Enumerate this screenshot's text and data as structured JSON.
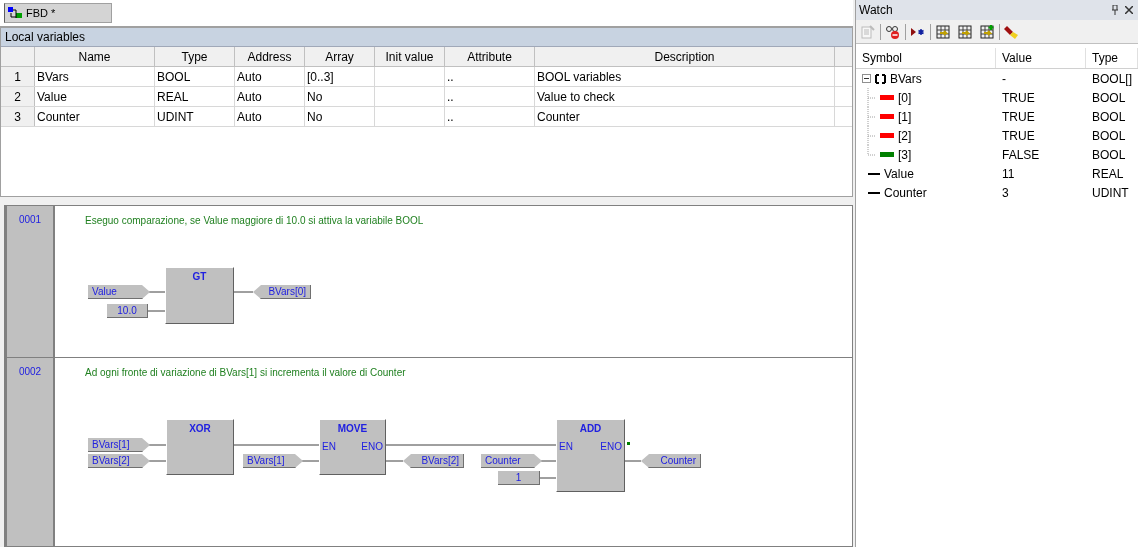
{
  "tabs": [
    {
      "label": "FBD *",
      "selected": true
    }
  ],
  "local_variables": {
    "title": "Local variables",
    "columns": [
      "Name",
      "Type",
      "Address",
      "Array",
      "Init value",
      "Attribute",
      "Description"
    ],
    "rows": [
      {
        "index": "1",
        "cells": [
          "BVars",
          "BOOL",
          "Auto",
          "[0..3]",
          "",
          "..",
          "BOOL variables"
        ]
      },
      {
        "index": "2",
        "cells": [
          "Value",
          "REAL",
          "Auto",
          "No",
          "",
          "..",
          "Value to check"
        ]
      },
      {
        "index": "3",
        "cells": [
          "Counter",
          "UDINT",
          "Auto",
          "No",
          "",
          "..",
          "Counter"
        ]
      }
    ]
  },
  "networks": [
    {
      "number": "0001",
      "comment": "Eseguo comparazione, se Value maggiore di 10.0 si attiva la variabile BOOL",
      "blocks": [
        {
          "name": "GT"
        }
      ],
      "elements": [
        {
          "kind": "input",
          "label": "Value"
        },
        {
          "kind": "constant",
          "label": "10.0"
        },
        {
          "kind": "output",
          "label": "BVars[0]"
        }
      ]
    },
    {
      "number": "0002",
      "comment": "Ad ogni fronte di variazione di BVars[1] si incrementa il valore di Counter",
      "blocks": [
        {
          "name": "XOR"
        },
        {
          "name": "MOVE",
          "pins": [
            "EN",
            "ENO"
          ]
        },
        {
          "name": "ADD",
          "pins": [
            "EN",
            "ENO"
          ]
        }
      ],
      "elements": [
        {
          "kind": "input",
          "label": "BVars[1]"
        },
        {
          "kind": "input",
          "label": "BVars[2]"
        },
        {
          "kind": "input",
          "label": "BVars[1]"
        },
        {
          "kind": "output",
          "label": "BVars[2]"
        },
        {
          "kind": "input",
          "label": "Counter"
        },
        {
          "kind": "constant",
          "label": "1"
        },
        {
          "kind": "output",
          "label": "Counter"
        }
      ]
    }
  ],
  "watch": {
    "title": "Watch",
    "columns": [
      "Symbol",
      "Value",
      "Type"
    ],
    "rows": [
      {
        "kind": "array",
        "symbol": "BVars",
        "value": "-",
        "type": "BOOL[]",
        "expanded": true,
        "children": [
          {
            "symbol": "[0]",
            "value": "TRUE",
            "type": "BOOL",
            "color": "#ff0000"
          },
          {
            "symbol": "[1]",
            "value": "TRUE",
            "type": "BOOL",
            "color": "#ff0000"
          },
          {
            "symbol": "[2]",
            "value": "TRUE",
            "type": "BOOL",
            "color": "#ff0000"
          },
          {
            "symbol": "[3]",
            "value": "FALSE",
            "type": "BOOL",
            "color": "#008000"
          }
        ]
      },
      {
        "kind": "scalar",
        "symbol": "Value",
        "value": "11",
        "type": "REAL"
      },
      {
        "kind": "scalar",
        "symbol": "Counter",
        "value": "3",
        "type": "UDINT"
      }
    ]
  }
}
